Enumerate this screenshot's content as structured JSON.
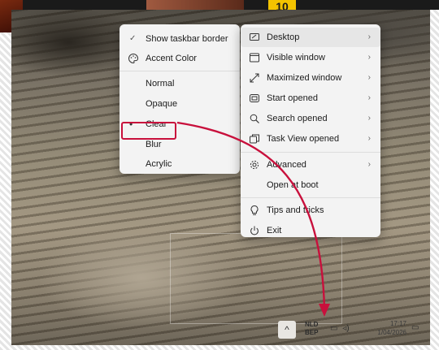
{
  "badge": "10",
  "colors": {
    "menu_bg": "#f3f3f3",
    "annotation": "#c8103c"
  },
  "style_menu": {
    "items": [
      {
        "label": "Show taskbar border",
        "checked": true,
        "icon": "check-icon"
      },
      {
        "label": "Accent Color",
        "icon": "palette-icon"
      },
      {
        "label": "Normal"
      },
      {
        "label": "Opaque"
      },
      {
        "label": "Clear",
        "selected": true
      },
      {
        "label": "Blur"
      },
      {
        "label": "Acrylic"
      }
    ]
  },
  "main_menu": {
    "items": [
      {
        "label": "Desktop",
        "icon": "desktop-icon",
        "submenu": true
      },
      {
        "label": "Visible window",
        "icon": "window-icon",
        "submenu": true
      },
      {
        "label": "Maximized window",
        "icon": "maximize-icon",
        "submenu": true
      },
      {
        "label": "Start opened",
        "icon": "start-icon",
        "submenu": true
      },
      {
        "label": "Search opened",
        "icon": "search-icon",
        "submenu": true
      },
      {
        "label": "Task View opened",
        "icon": "task-view-icon",
        "submenu": true
      },
      {
        "label": "Advanced",
        "icon": "gear-icon",
        "submenu": true
      },
      {
        "label": "Open at boot"
      },
      {
        "label": "Tips and tricks",
        "icon": "lightbulb-icon"
      },
      {
        "label": "Exit",
        "icon": "power-icon"
      }
    ]
  },
  "taskbar": {
    "overflow_label": "^",
    "lang_line1": "NLD",
    "lang_line2": "BEP",
    "time": "17:17",
    "date": "1/04/2026"
  }
}
